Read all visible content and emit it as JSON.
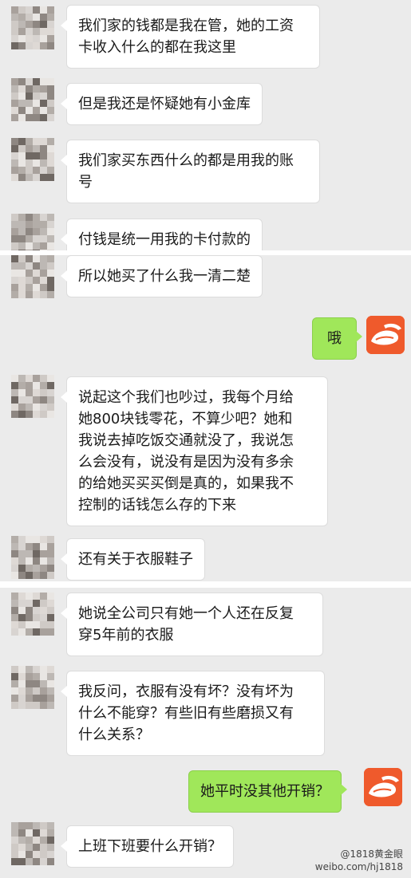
{
  "messages": {
    "m1": "我们家的钱都是我在管，她的工资\n卡收入什么的都在我这里",
    "m2": "但是我还是怀疑她有小金库",
    "m3": "我们家买东西什么的都是用我的账\n号",
    "m4": "付钱是统一用我的卡付款的",
    "m5": "所以她买了什么我一清二楚",
    "m6_me": "哦",
    "m7": "说起这个我们也吵过，我每个月给\n她800块钱零花，不算少吧？她和\n我说去掉吃饭交通就没了，我说怎\n么会没有，说没有是因为没有多余\n的给她买买买倒是真的，如果我不\n控制的话钱怎么存的下来",
    "m8": "还有关于衣服鞋子",
    "m9": "她说全公司只有她一个人还在反复\n穿5年前的衣服",
    "m10": "我反问，衣服有没有坏？没有坏为\n什么不能穿？有些旧有些磨损又有\n什么关系？",
    "m11_me": "她平时没其他开销？",
    "m12": "上班下班要什么开销？"
  },
  "watermark": {
    "line1": "@1818黄金眼",
    "line2": "weibo.com/hj1818"
  },
  "colors": {
    "chat_bg": "#ebebeb",
    "my_bubble": "#a0e75a",
    "my_avatar": "#ef5a2c"
  },
  "icons": {
    "contact_avatar": "pixelated-avatar",
    "my_avatar": "orange-shoe-logo-icon"
  }
}
